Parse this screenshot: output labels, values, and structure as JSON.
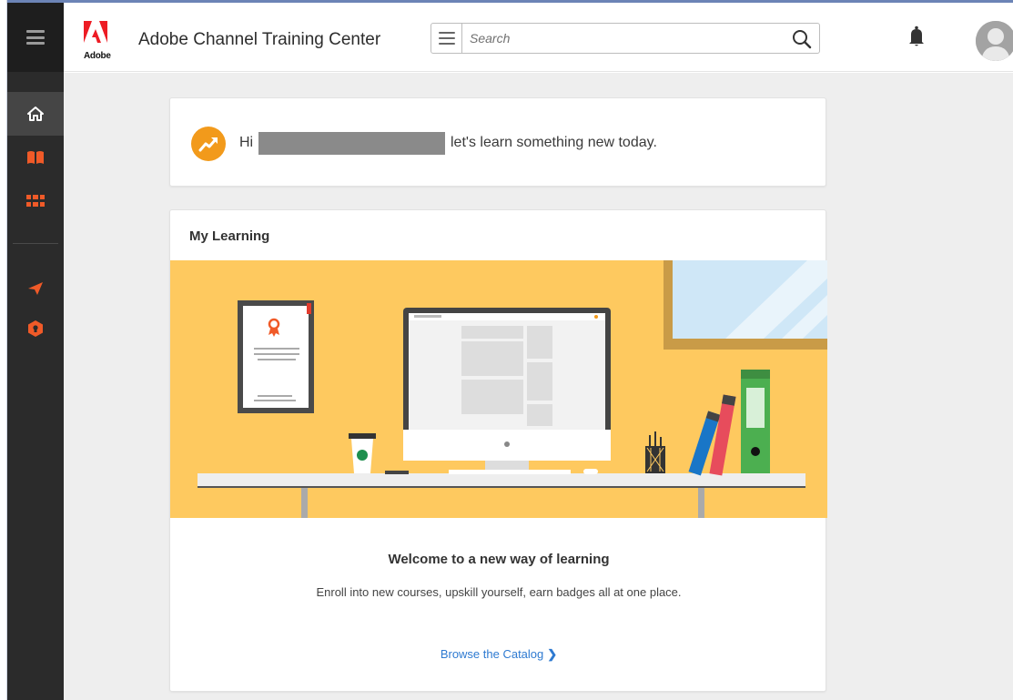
{
  "header": {
    "brand_mark": "Adobe",
    "app_title": "Adobe Channel Training Center",
    "search_placeholder": "Search"
  },
  "sidebar": {
    "items": [
      {
        "name": "home",
        "active": true
      },
      {
        "name": "catalog",
        "active": false
      },
      {
        "name": "apps",
        "active": false
      },
      {
        "name": "send",
        "active": false
      },
      {
        "name": "badge",
        "active": false
      }
    ]
  },
  "greeting": {
    "hi": "Hi",
    "message": "let's learn something new today."
  },
  "my_learning": {
    "title": "My Learning",
    "welcome_title": "Welcome to a new way of learning",
    "welcome_text": "Enroll into new courses, upskill yourself, earn badges all at one place.",
    "browse_link": "Browse the Catalog",
    "browse_chevron": "❯"
  },
  "colors": {
    "sidebar_bg": "#2b2b2b",
    "accent_orange": "#f29a1b",
    "adobe_red": "#ed1c24",
    "hero_bg": "#fec95f",
    "link_blue": "#2e7ad1"
  }
}
